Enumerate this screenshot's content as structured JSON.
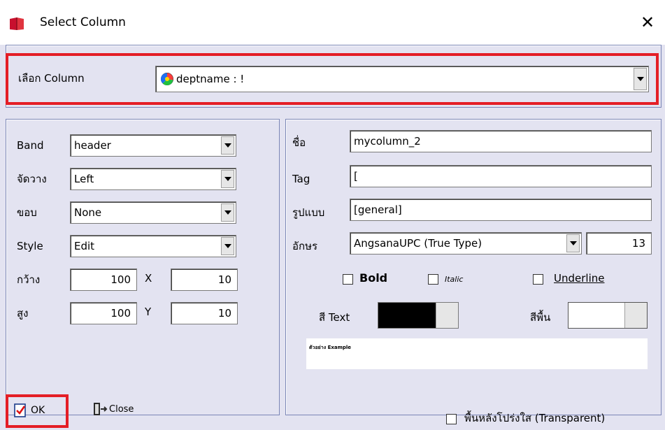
{
  "window": {
    "title": "Select Column",
    "close_glyph": "✕"
  },
  "column_select": {
    "label": "เลือก Column",
    "value": "deptname : !"
  },
  "left_panel": {
    "band": {
      "label": "Band",
      "value": "header"
    },
    "align": {
      "label": "จัดวาง",
      "value": "Left"
    },
    "border": {
      "label": "ขอบ",
      "value": "None"
    },
    "style": {
      "label": "Style",
      "value": "Edit"
    },
    "width": {
      "label": "กว้าง",
      "value": "100"
    },
    "x": {
      "label": "X",
      "value": "10"
    },
    "height": {
      "label": "สูง",
      "value": "100"
    },
    "y": {
      "label": "Y",
      "value": "10"
    }
  },
  "right_panel": {
    "name": {
      "label": "ชื่อ",
      "value": "mycolumn_2"
    },
    "tag": {
      "label": "Tag",
      "value": "["
    },
    "format": {
      "label": "รูปแบบ",
      "value": "[general]"
    },
    "font": {
      "label": "อักษร",
      "value": "AngsanaUPC (True Type)",
      "size": "13"
    },
    "bold_label": "Bold",
    "italic_label": "Italic",
    "underline_label": "Underline",
    "text_color": {
      "label": "สี Text",
      "color": "#000000"
    },
    "background_color": {
      "label": "สีพื้น",
      "color": "#ffffff"
    },
    "preview_text": "ตัวอย่าง Example"
  },
  "footer": {
    "ok_label": "OK",
    "close_label": "Close",
    "transparent_label": "พื้นหลังโปร่งใส (Transparent)"
  },
  "colors": {
    "dialog_bg": "#e3e3f1",
    "panel_border": "#7b86b6",
    "highlight": "#e41e26"
  }
}
